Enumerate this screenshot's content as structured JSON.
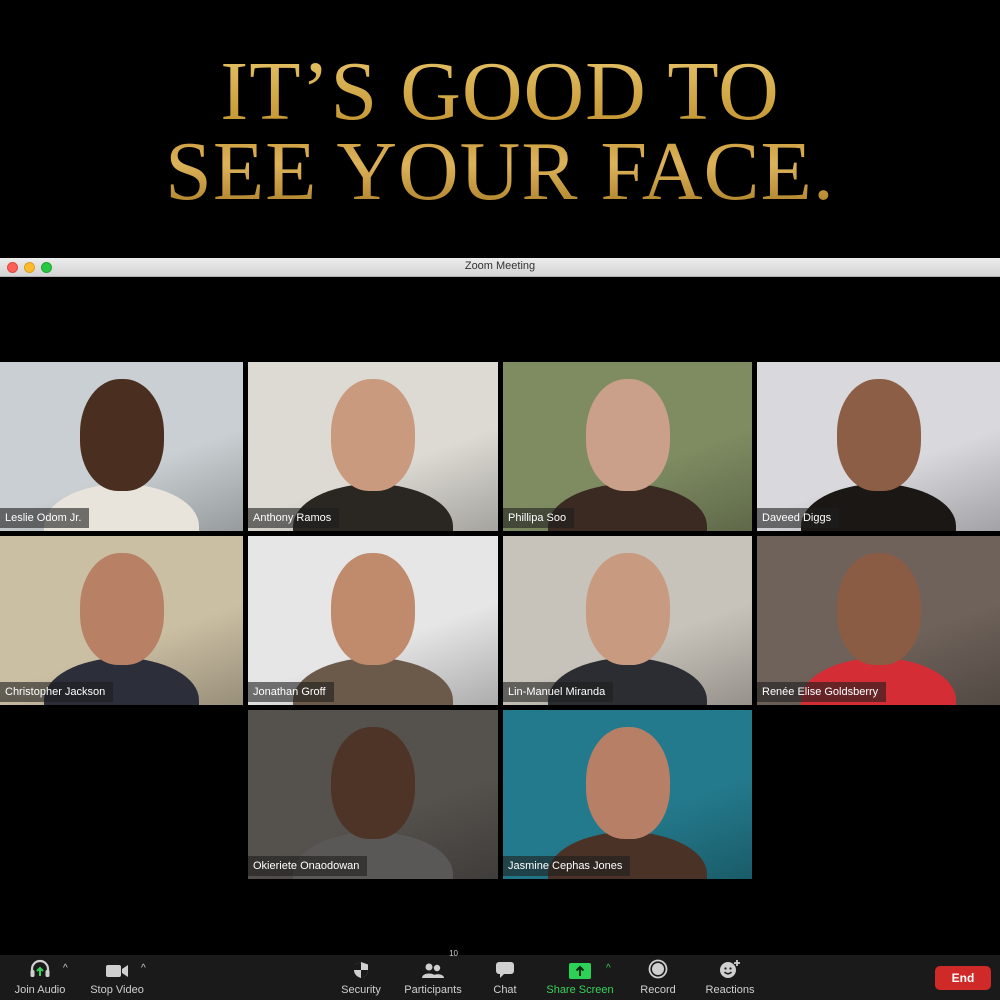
{
  "headline": {
    "line1": "IT’S GOOD TO",
    "line2": "SEE YOUR FACE."
  },
  "window": {
    "title": "Zoom Meeting",
    "buttons": [
      "close",
      "minimize",
      "maximize"
    ]
  },
  "participants": [
    {
      "name": "Leslie Odom Jr.",
      "bg": "#c9cfd2",
      "skin": "#4a2e20",
      "shirt": "#e8e4dc"
    },
    {
      "name": "Anthony Ramos",
      "bg": "#dcdad3",
      "skin": "#c99a7e",
      "shirt": "#2a2622"
    },
    {
      "name": "Phillipa Soo",
      "bg": "#7f8c62",
      "skin": "#caa08a",
      "shirt": "#3a2a22"
    },
    {
      "name": "Daveed Diggs",
      "bg": "#d9d8dc",
      "skin": "#8b5e45",
      "shirt": "#1a1714"
    },
    {
      "name": "Christopher Jackson",
      "bg": "#cbbfa3",
      "skin": "#b88064",
      "shirt": "#2c2e3a"
    },
    {
      "name": "Jonathan Groff",
      "bg": "#e6e6e6",
      "skin": "#c08b6c",
      "shirt": "#6b5a4a"
    },
    {
      "name": "Lin-Manuel Miranda",
      "bg": "#c8c3ba",
      "skin": "#c89a80",
      "shirt": "#2b2d33"
    },
    {
      "name": "Renée Elise Goldsberry",
      "bg": "#6e625a",
      "skin": "#8b5c44",
      "shirt": "#d42d36"
    },
    {
      "name": "Okieriete Onaodowan",
      "bg": "#55514d",
      "skin": "#4d3426",
      "shirt": "#5a5856"
    },
    {
      "name": "Jasmine Cephas Jones",
      "bg": "#237a8c",
      "skin": "#b67f66",
      "shirt": "#4a3226"
    }
  ],
  "toolbar": {
    "join_audio": "Join Audio",
    "stop_video": "Stop Video",
    "security": "Security",
    "participants": "Participants",
    "participant_count": "10",
    "chat": "Chat",
    "share_screen": "Share Screen",
    "record": "Record",
    "reactions": "Reactions",
    "end": "End",
    "colors": {
      "share_green": "#3ad15b",
      "end_red": "#cf2a27"
    }
  }
}
